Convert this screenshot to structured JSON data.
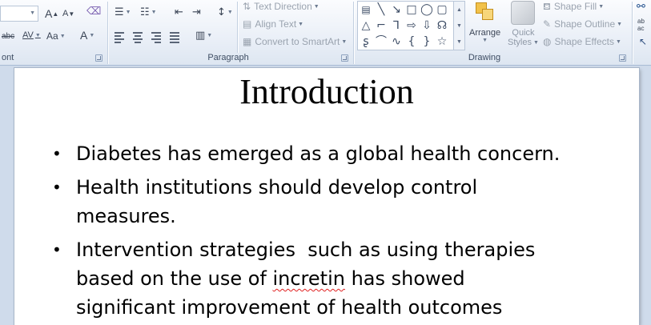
{
  "ribbon": {
    "font_group": {
      "label": "ont",
      "grow_font": "A",
      "shrink_font": "A",
      "strikethrough": "abc",
      "char_spacing": "AV",
      "change_case": "Aa",
      "font_color": "A"
    },
    "paragraph_group": {
      "label": "Paragraph",
      "text_direction": "Text Direction",
      "align_text": "Align Text",
      "convert_smartart": "Convert to SmartArt"
    },
    "drawing_group": {
      "label": "Drawing",
      "arrange": "Arrange",
      "quick_styles_line1": "Quick",
      "quick_styles_line2": "Styles",
      "shape_fill": "Shape Fill",
      "shape_outline": "Shape Outline",
      "shape_effects": "Shape Effects"
    },
    "editing_group": {
      "replace_glyph": "ab\nac"
    }
  },
  "slide": {
    "title": "Introduction",
    "bullets": [
      {
        "text": "Diabetes has emerged as a global health concern."
      },
      {
        "line1": "Health institutions should develop control",
        "line2": "measures."
      },
      {
        "line1": "Intervention strategies  such as using therapies",
        "line2_pre": "based on the use of ",
        "line2_mark": "incretin",
        "line2_post": " has showed",
        "line3": "significant improvement of health outcomes"
      }
    ]
  },
  "colors": {
    "ribbon_border": "#a9bcd6",
    "workspace_bg": "#cfdbeb",
    "spell_error": "#e02020"
  }
}
